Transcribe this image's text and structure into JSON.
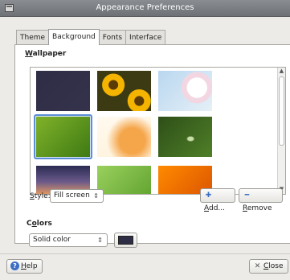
{
  "window": {
    "title": "Appearance Preferences"
  },
  "tabs": [
    {
      "label": "Theme",
      "active": false
    },
    {
      "label": "Background",
      "active": true
    },
    {
      "label": "Fonts",
      "active": false
    },
    {
      "label": "Interface",
      "active": false
    }
  ],
  "wallpaper": {
    "section_label": "Wallpaper",
    "items": [
      {
        "name": "dark-slate-solid",
        "colors": [
          "#2e2d45",
          "#34334b"
        ],
        "selected": false
      },
      {
        "name": "sunflowers",
        "colors": [
          "#f5b400",
          "#3b3a12"
        ],
        "selected": false
      },
      {
        "name": "white-blossom",
        "colors": [
          "#b9d7ef",
          "#f4eef2"
        ],
        "selected": false
      },
      {
        "name": "green-leaf",
        "colors": [
          "#7fb229",
          "#3f7a14"
        ],
        "selected": true
      },
      {
        "name": "orange-flower-light",
        "colors": [
          "#fff1d9",
          "#f5a64b"
        ],
        "selected": false
      },
      {
        "name": "water-drop-green",
        "colors": [
          "#2e4f18",
          "#4f7f28"
        ],
        "selected": false
      },
      {
        "name": "sunset-sky",
        "colors": [
          "#2a2b53",
          "#f2a05a"
        ],
        "selected": false
      },
      {
        "name": "green-leaf-veins",
        "colors": [
          "#9ad05e",
          "#5c9f2b"
        ],
        "selected": false
      },
      {
        "name": "orange-petals",
        "colors": [
          "#ff8a00",
          "#d84f00"
        ],
        "selected": false
      }
    ]
  },
  "style": {
    "label": "Style:",
    "value": "Fill screen"
  },
  "buttons": {
    "add": "Add...",
    "remove": "Remove",
    "help": "Help",
    "close": "Close"
  },
  "colors": {
    "section_label": "Colors",
    "mode": "Solid color",
    "swatch": "#2e2d45"
  },
  "theme": {
    "accent": "#5b8ed6"
  }
}
